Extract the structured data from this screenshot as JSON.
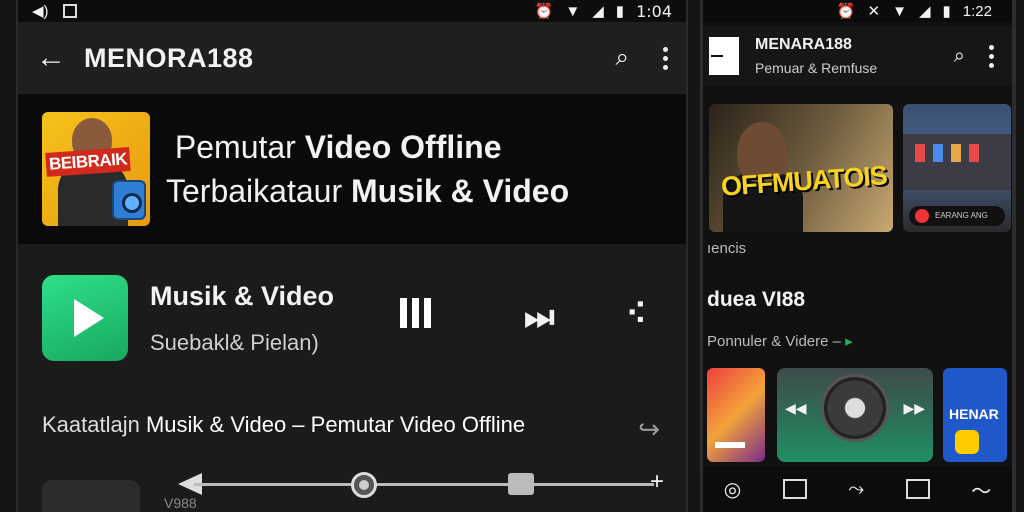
{
  "left_phone": {
    "status": {
      "time": "1:04"
    },
    "appbar": {
      "title": "MENORA188"
    },
    "banner": {
      "album_stamp": "BEIBRAIK",
      "line1_normal": "Pemutar ",
      "line1_bold": "Video Offline",
      "line2_normal": "Terbaikataur ",
      "line2_bold": "Musik & Video"
    },
    "player": {
      "title": "Musik & Video",
      "subtitle": "Suebakl& Pielan)"
    },
    "now_line": {
      "prefix": "Kaatatlajn ",
      "text": "Musik & Video – Pemutar Video Offline"
    },
    "seek": {
      "progress": 0.37
    },
    "bottom_label": "V988"
  },
  "right_phone": {
    "status": {
      "time": "1:22"
    },
    "appbar": {
      "title": "MENARA188",
      "subtitle": "Pemuar & Remfuse"
    },
    "card1_text": "OFFMUATOIS",
    "card2_pill": "EARANG ANG PEMUAR",
    "label_a": "ıencis",
    "label_b": "dueа VI88",
    "label_c": "Ponnuler & Videre –",
    "tile3_brand": "HENAR"
  },
  "icons": {
    "back": "←",
    "search": "⌕",
    "next": "⏭",
    "share": "⤴",
    "forward": "↪",
    "plus": "+",
    "volume": "◀",
    "wifi": "▼",
    "alarm": "⏰"
  },
  "colors": {
    "accent_green": "#1fc574",
    "album_yellow": "#f5c21b",
    "stamp_red": "#d12a1c",
    "tile_blue": "#1e58c9"
  }
}
